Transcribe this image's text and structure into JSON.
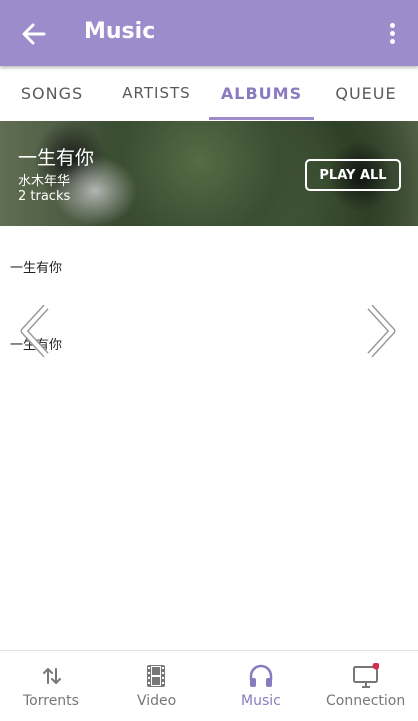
{
  "app_bar": {
    "title": "Music"
  },
  "tabs": [
    {
      "label": "SONGS"
    },
    {
      "label": "ARTISTS"
    },
    {
      "label": "ALBUMS"
    },
    {
      "label": "QUEUE"
    }
  ],
  "active_tab": "ALBUMS",
  "album": {
    "title": "一生有你",
    "artist": "水木年华",
    "tracks": "2 tracks",
    "play_all": "PLAY ALL"
  },
  "track_list": [
    {
      "title": "一生有你"
    },
    {
      "title": "一生有你"
    }
  ],
  "bottom_nav": [
    {
      "label": "Torrents",
      "icon": "transfer-arrows-icon"
    },
    {
      "label": "Video",
      "icon": "film-icon"
    },
    {
      "label": "Music",
      "icon": "headphones-icon"
    },
    {
      "label": "Connection",
      "icon": "monitor-icon"
    }
  ],
  "colors": {
    "primary": "#9c8ccb",
    "accent": "#8a7bc1",
    "notification_dot": "#d32f4f"
  }
}
